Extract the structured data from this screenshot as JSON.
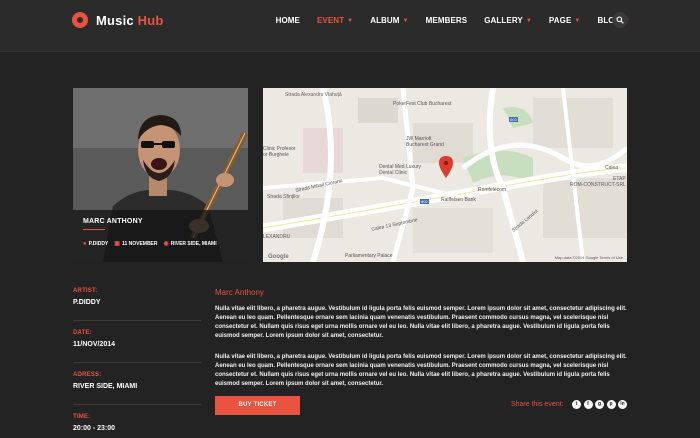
{
  "header": {
    "logo_main": "Music ",
    "logo_accent": "Hub",
    "nav": [
      {
        "label": "HOME",
        "active": false,
        "caret": false
      },
      {
        "label": "EVENT",
        "active": true,
        "caret": true
      },
      {
        "label": "ALBUM",
        "active": false,
        "caret": true
      },
      {
        "label": "MEMBERS",
        "active": false,
        "caret": false
      },
      {
        "label": "GALLERY",
        "active": false,
        "caret": true
      },
      {
        "label": "PAGE",
        "active": false,
        "caret": true
      },
      {
        "label": "BLOG",
        "active": false,
        "caret": true
      }
    ]
  },
  "hero": {
    "artist_name": "MARC ANTHONY",
    "meta": {
      "performer": "P.DIDDY",
      "date": "11 NOVEMBER",
      "location": "RIVER SIDE, MIAMI"
    }
  },
  "map": {
    "labels": {
      "pokerfest": "PokerFest Club Bucharest",
      "jw": "JW Marriott\nBucharest Grand",
      "dental": "Dental Med Luxury\nDental Clinic",
      "clinic": "Clinic Profesor\nor Burghele",
      "romtelecom": "Romtelecom",
      "raiffeisen": "Raiffeisen Bank",
      "parliament": "Parliamentary Palace",
      "rom_constr": "ROM-CONSTRUCT-SRL",
      "calea": "Calea",
      "calea13": "Calea 13 Septembrie",
      "ciorani": "Strada Mihail Cioranu",
      "sfintilor": "Strada Sfinților",
      "lanului": "Strada Lanului",
      "alexandru": "Strada Alexandru Vlahuță",
      "lexandru": "LEXANDRU",
      "n603": "603",
      "n602": "602",
      "etap": "ETAP"
    },
    "google_label": "Google",
    "footer": "Map data ©2014 Google   Terms of Use"
  },
  "info": [
    {
      "label": "ARTIST:",
      "value": "P.DIDDY"
    },
    {
      "label": "DATE:",
      "value": "11/NOV/2014"
    },
    {
      "label": "ADRESS:",
      "value": "RIVER SIDE, MIAMI"
    },
    {
      "label": "TIME:",
      "value": "20:00 - 23:00"
    }
  ],
  "description": {
    "title": "Marc Anthony",
    "paragraphs": [
      "Nulla vitae elit libero, a pharetra augue. Vestibulum id ligula porta felis euismod semper. Lorem ipsum dolor sit amet, consectetur adipiscing elit. Aenean eu leo quam. Pellentesque ornare sem lacinia quam venenatis vestibulum. Praesent commodo cursus magna, vel scelerisque nisl consectetur et. Nullam quis risus eget urna mollis ornare vel eu leo. Nulla vitae elit libero, a pharetra augue. Vestibulum id ligula porta felis euismod semper. Lorem ipsum dolor sit amet, consectetur.",
      "Nulla vitae elit libero, a pharetra augue. Vestibulum id ligula porta felis euismod semper. Lorem ipsum dolor sit amet, consectetur adipiscing elit. Aenean eu leo quam. Pellentesque ornare sem lacinia quam venenatis vestibulum. Praesent commodo cursus magna, vel scelerisque nisl consectetur et. Nullam quis risus eget urna mollis ornare vel eu leo. Nulla vitae elit libero, a pharetra augue. Vestibulum id ligula porta felis euismod semper. Lorem ipsum dolor sit amet, consectetur."
    ]
  },
  "ticket_button": "BUY TICKET",
  "share": {
    "label": "Share this event:",
    "icons": [
      "twitter-icon",
      "facebook-icon",
      "google-plus-icon",
      "pinterest-icon",
      "linkedin-icon"
    ]
  },
  "colors": {
    "accent": "#e8543f",
    "background": "#232323",
    "header": "#2b2b2b"
  }
}
